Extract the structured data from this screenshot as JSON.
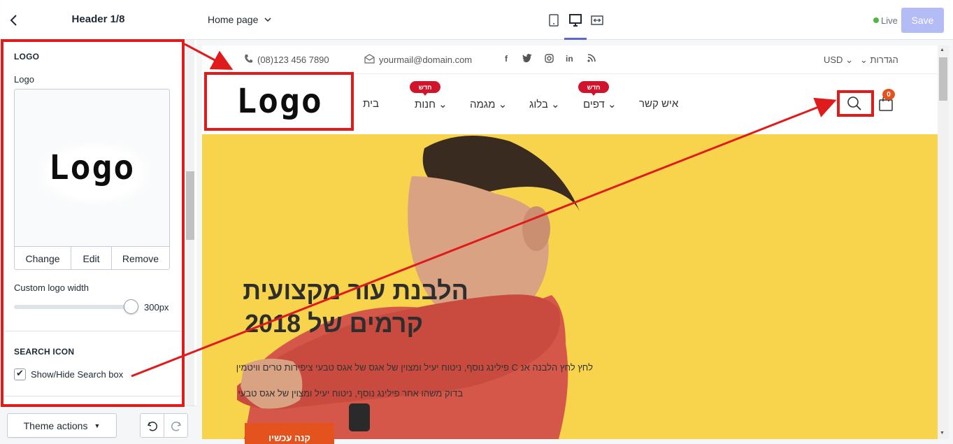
{
  "sidebar": {
    "header_title": "Header 1/8",
    "logo_section": {
      "title": "LOGO",
      "field_label": "Logo",
      "logo_text": "Logo",
      "actions": [
        "Change",
        "Edit",
        "Remove"
      ],
      "width_label": "Custom logo width",
      "width_value": "300px",
      "width_fraction": 1.0
    },
    "search_section": {
      "title": "SEARCH ICON",
      "checkbox_label": "Show/Hide Search box",
      "checked": true
    },
    "footer": {
      "theme_actions_label": "Theme actions"
    }
  },
  "topbar": {
    "page_select": "Home page",
    "views": [
      "mobile-icon",
      "desktop-icon",
      "fullwidth-icon"
    ],
    "active_view": "desktop-icon",
    "live_label": "Live",
    "save_label": "Save"
  },
  "store": {
    "phone": "(08)123 456 7890",
    "email": "yourmail@domain.com",
    "social_icons": [
      "facebook-icon",
      "twitter-icon",
      "instagram-icon",
      "linkedin-icon",
      "rss-icon"
    ],
    "currency": "USD",
    "settings": "הגדרות",
    "logo_text": "Logo",
    "nav": [
      {
        "label": "בית"
      },
      {
        "label": "חנות",
        "badge": "חדש"
      },
      {
        "label": "מגמה"
      },
      {
        "label": "בלוג"
      },
      {
        "label": "דפים",
        "badge": "חדש"
      },
      {
        "label": "איש קשר"
      }
    ],
    "cart_count": "0",
    "hero": {
      "heading_line1": "הלבנת עור מקצועית",
      "heading_line2": "קרמים של 2018",
      "text_line1": "לחץ לחץ הלבנה אנ C פילינג נוסף, ניטוח יעיל ומצוין של אגס של אגס טבעי ציפירות טרים וויטמין",
      "text_line2": "בדוק משהו אחר פילינג נוסף, ניטוח יעיל ומצוין של אגס טבעי",
      "button_label": "קנה עכשיו"
    }
  },
  "colors": {
    "accent": "#5c6ac4",
    "save_disabled": "#b3bcf5",
    "live": "#50b83c",
    "hero_bg": "#f8d44c",
    "badge": "#d0142c",
    "annotation": "#e01b1b",
    "cta": "#e4531e"
  }
}
